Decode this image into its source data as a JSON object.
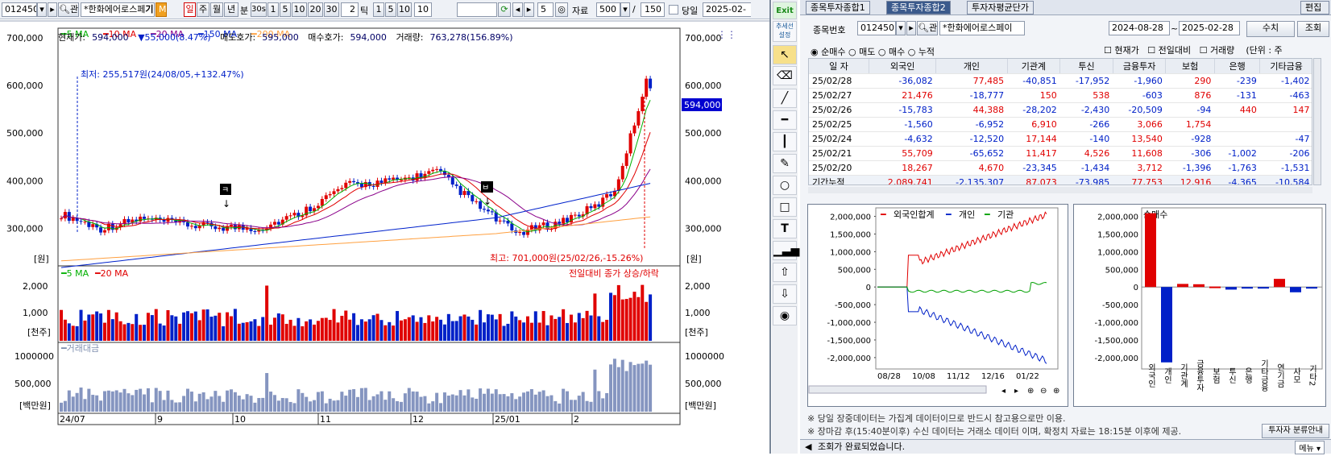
{
  "toolbar": {
    "code": "012450",
    "name": "*한화에어로스페",
    "name_suffix": "기",
    "periods": [
      "일",
      "주",
      "월",
      "년"
    ],
    "minute_label": "분",
    "minute_opt": "30s",
    "nums": [
      "1",
      "5",
      "10",
      "20",
      "30"
    ],
    "tick_val": "2",
    "tick_label": "틱",
    "tick_nums": [
      "1",
      "5",
      "10"
    ],
    "tick_input": "10",
    "page_val": "5",
    "data_label": "자료",
    "data_count": "500",
    "slash": "/",
    "total": "150",
    "today_label": "당일",
    "date": "2025-02-"
  },
  "info": {
    "price_label": "현재가:",
    "price": "594,000",
    "change": "▼55,000(8.47%)",
    "ask_label": "매도호가:",
    "ask": "595,000",
    "bid_label": "매수호가:",
    "bid": "594,000",
    "vol_label": "거래량:",
    "vol": "763,278(156.89%)"
  },
  "legend_price": [
    "5 MA",
    "10 MA",
    "20 MA",
    "150 MA",
    "200 MA"
  ],
  "legend_colors": [
    "#00b000",
    "#e00000",
    "#8a008a",
    "#0022cc",
    "#ffa040"
  ],
  "price_axis": [
    "700,000",
    "600,000",
    "500,000",
    "400,000",
    "300,000"
  ],
  "unit_won": "[원]",
  "low_note": "최저: 255,517원(24/08/05,+132.47%)",
  "high_note": "최고: 701,000원(25/02/26,-15.26%)",
  "price_tag": "594,000",
  "sig_sell": "ㅋ",
  "sig_buy": "ㅂ",
  "vol_legend": [
    "5 MA",
    "20 MA"
  ],
  "vol_axis": [
    "2,000",
    "1,000"
  ],
  "vol_unit": "[천주]",
  "vol_note": "전일대비 종가 상승/하락",
  "amt_legend": "거래대금",
  "amt_axis": [
    "1000000",
    "500,000"
  ],
  "amt_unit": "[백만원]",
  "x_labels": [
    "24/07",
    "9",
    "10",
    "11",
    "12",
    "25/01",
    "2"
  ],
  "tools": {
    "exit": "Exit",
    "trend": "추세선 설정"
  },
  "right": {
    "tabs": [
      "종목투자종합1",
      "종목투자종합2",
      "투자자평균단가"
    ],
    "edit": "편집",
    "code_label": "종목번호",
    "code": "012450",
    "name": "*한화에어로스페이",
    "date_from": "2024-08-28",
    "date_to": "2025-02-28",
    "query": "수치",
    "refresh": "조회",
    "chk": [
      "현재가",
      "전일대비",
      "거래량"
    ],
    "unit": "(단위 : 주",
    "radios": [
      "순매수",
      "매도",
      "매수",
      "누적"
    ],
    "headers": [
      "일 자",
      "외국인",
      "개인",
      "기관계",
      "투신",
      "금융투자",
      "보험",
      "은행",
      "기타금융"
    ],
    "rows": [
      [
        "25/02/28",
        "-36,082",
        "77,485",
        "-40,851",
        "-17,952",
        "-1,960",
        "290",
        "-239",
        "-1,402"
      ],
      [
        "25/02/27",
        "21,476",
        "-18,777",
        "150",
        "538",
        "-603",
        "876",
        "-131",
        "-463"
      ],
      [
        "25/02/26",
        "-15,783",
        "44,388",
        "-28,202",
        "-2,430",
        "-20,509",
        "-94",
        "440",
        "147"
      ],
      [
        "25/02/25",
        "-1,560",
        "-6,952",
        "6,910",
        "-266",
        "3,066",
        "1,754",
        "",
        ""
      ],
      [
        "25/02/24",
        "-4,632",
        "-12,520",
        "17,144",
        "-140",
        "13,540",
        "-928",
        "",
        "-47"
      ],
      [
        "25/02/21",
        "55,709",
        "-65,652",
        "11,417",
        "4,526",
        "11,608",
        "-306",
        "-1,002",
        "-206"
      ],
      [
        "25/02/20",
        "18,267",
        "4,670",
        "-23,345",
        "-1,434",
        "3,712",
        "-1,396",
        "-1,763",
        "-1,531"
      ],
      [
        "기간누적",
        "2,089,741",
        "-2,135,307",
        "87,073",
        "-73,985",
        "77,753",
        "12,916",
        "-4,365",
        "-10,584"
      ]
    ],
    "line_legend": [
      "외국인합계",
      "개인",
      "기관"
    ],
    "line_axis": [
      "2,000,000",
      "1,500,000",
      "1,000,000",
      "500,000",
      "0",
      "-500,000",
      "-1,000,000",
      "-1,500,000",
      "-2,000,000"
    ],
    "line_x": [
      "08/28",
      "10/08",
      "11/12",
      "12/16",
      "01/22"
    ],
    "bar_title": "순매수",
    "bar_axis": [
      "2,000,000",
      "1,500,000",
      "1,000,000",
      "500,000",
      "0",
      "-500,000",
      "-1,000,000",
      "-1,500,000",
      "-2,000,000"
    ],
    "bar_cats": [
      "외국인",
      "개인",
      "기관계",
      "금융투자",
      "보험",
      "투신",
      "은행",
      "기타금융",
      "연기금",
      "사모",
      "기타2"
    ],
    "bar_vals": [
      2089741,
      -2135307,
      87073,
      77753,
      12916,
      -73985,
      -4365,
      -10584,
      230000,
      -150000,
      -20000
    ],
    "notes": [
      "※ 당일 장중데이터는 가집계 데이터이므로 반드시 참고용으로만 이용.",
      "※ 장마감 후(15:40분이후) 수신 데이터는 거래소 데이터 이며, 확정치 자료는 18:15분 이후에 제공."
    ],
    "bottom_btn": "투자자 분류안내",
    "status": "조회가 완료되었습니다.",
    "menu": "메뉴"
  }
}
